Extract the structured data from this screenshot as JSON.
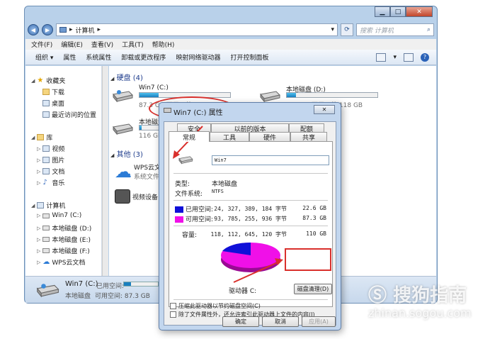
{
  "window": {
    "title_buttons": {
      "minimize": "▁",
      "maximize": "□",
      "close": "✕"
    },
    "address": {
      "path": "计算机",
      "separator": "▸"
    },
    "search": {
      "placeholder": "搜索 计算机"
    }
  },
  "menubar": [
    {
      "label": "文件(F)"
    },
    {
      "label": "编辑(E)"
    },
    {
      "label": "查看(V)"
    },
    {
      "label": "工具(T)"
    },
    {
      "label": "帮助(H)"
    }
  ],
  "toolbar": [
    {
      "label": "组织 ▾"
    },
    {
      "label": "属性"
    },
    {
      "label": "系统属性"
    },
    {
      "label": "卸载或更改程序"
    },
    {
      "label": "映射网络驱动器"
    },
    {
      "label": "打开控制面板"
    }
  ],
  "sidebar": {
    "favorites": "收藏夹",
    "fav_items": [
      "下载",
      "桌面",
      "最近访问的位置"
    ],
    "libraries": "库",
    "lib_items": [
      "视频",
      "图片",
      "文档",
      "音乐"
    ],
    "computer": "计算机",
    "comp_items": [
      "Win7 (C:)",
      "本地磁盘 (D:)",
      "本地磁盘 (E:)",
      "本地磁盘 (F:)",
      "WPS云文档"
    ]
  },
  "content": {
    "group_hdd": "硬盘 (4)",
    "group_other": "其他 (3)",
    "drives": [
      {
        "name": "Win7 (C:)",
        "size": "87.3 GB 可用，共 110 GB",
        "fill": 0.21
      },
      {
        "name": "本地磁盘 (D:)",
        "size": "106 GB 可用，共 118 GB",
        "fill": 0.1
      },
      {
        "name": "本地磁盘",
        "size": "116 GB",
        "fill": 0.02
      }
    ],
    "others": [
      {
        "name": "WPS云文",
        "sub": "系统文件"
      },
      {
        "name": "视频设备"
      }
    ]
  },
  "statusbar": {
    "name": "Win7 (C:)",
    "used_label": "已用空间:",
    "type": "本地磁盘",
    "free": "可用空间: 87.3 GB"
  },
  "dialog": {
    "title": "Win7 (C:) 属性",
    "close": "✕",
    "tabs_top": [
      "安全",
      "以前的版本",
      "配额"
    ],
    "tabs_bottom": [
      "常规",
      "工具",
      "硬件",
      "共享"
    ],
    "volume_name": "Win7",
    "type_label": "类型:",
    "type_value": "本地磁盘",
    "fs_label": "文件系统:",
    "fs_value": "NTFS",
    "used_label": "已用空间:",
    "used_bytes": "24, 327, 389, 184 字节",
    "used_gb": "22.6 GB",
    "free_label": "可用空间:",
    "free_bytes": "93, 785, 255, 936 字节",
    "free_gb": "87.3 GB",
    "cap_label": "容量:",
    "cap_bytes": "118, 112, 645, 120 字节",
    "cap_gb": "110 GB",
    "drive_label": "驱动器 C:",
    "cleanup": "磁盘清理(D)",
    "compress": "压缩此驱动器以节约磁盘空间(C)",
    "index": "除了文件属性外，还允许索引此驱动器上文件的内容(I)",
    "ok": "确定",
    "cancel": "取消",
    "apply": "应用(A)",
    "used_color": "#1010d8",
    "free_color": "#f010e8"
  },
  "watermark": {
    "brand": "搜狗指南",
    "site": "zhinan.sogou.com"
  }
}
